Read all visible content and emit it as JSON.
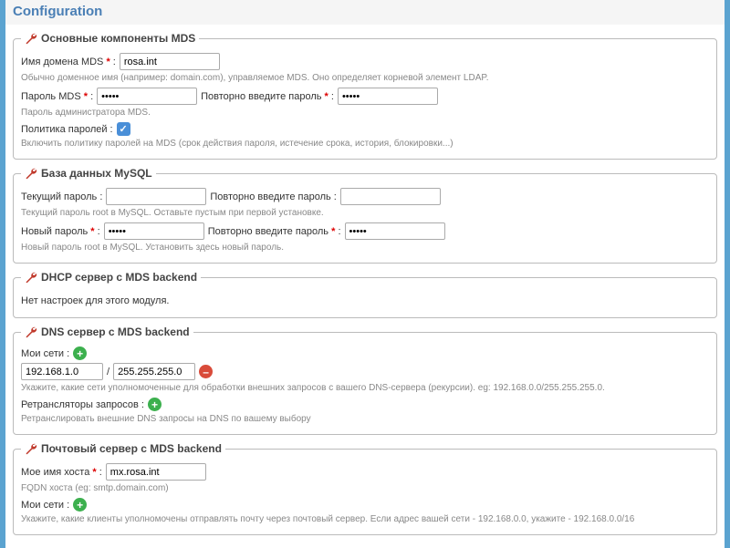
{
  "title": "Configuration",
  "sections": {
    "mds": {
      "legend": "Основные компоненты MDS",
      "domain_label": "Имя домена MDS",
      "domain_value": "rosa.int",
      "domain_help": "Обычно доменное имя (например: domain.com), управляемое MDS. Оно определяет корневой элемент LDAP.",
      "password_label": "Пароль MDS",
      "password_value": "•••••",
      "password_confirm_label": "Повторно введите пароль",
      "password_confirm_value": "•••••",
      "password_help": "Пароль администратора MDS.",
      "policy_label": "Политика паролей :",
      "policy_help": "Включить политику паролей на MDS (срок действия пароля, истечение срока, история, блокировки...)"
    },
    "mysql": {
      "legend": "База данных MySQL",
      "current_label": "Текущий пароль :",
      "confirm_label": "Повторно введите пароль :",
      "current_help": "Текущий пароль root в MySQL. Оставьте пустым при первой установке.",
      "new_label": "Новый пароль",
      "new_value": "•••••",
      "new_confirm_label": "Повторно введите пароль",
      "new_confirm_value": "•••••",
      "new_help": "Новый пароль root в MySQL. Установить здесь новый пароль."
    },
    "dhcp": {
      "legend": "DHCP сервер с MDS backend",
      "empty": "Нет настроек для этого модуля."
    },
    "dns": {
      "legend": "DNS сервер с MDS backend",
      "networks_label": "Мои сети :",
      "net_ip": "192.168.1.0",
      "net_mask": "255.255.255.0",
      "networks_help": "Укажите, какие сети уполномоченные для обработки внешних запросов с вашего DNS-сервера (рекурсии). eg: 192.168.0.0/255.255.255.0.",
      "forwarders_label": "Ретрансляторы запросов :",
      "forwarders_help": "Ретранслировать внешние DNS запросы на DNS по вашему выбору"
    },
    "mail": {
      "legend": "Почтовый сервер с MDS backend",
      "hostname_label": "Мое имя хоста",
      "hostname_value": "mx.rosa.int",
      "hostname_help": "FQDN хоста (eg: smtp.domain.com)",
      "networks_label": "Мои сети :",
      "networks_help": "Укажите, какие клиенты уполномочены отправлять почту через почтовый сервер. Если адрес вашей сети - 192.168.0.0, укажите - 192.168.0.0/16"
    }
  }
}
